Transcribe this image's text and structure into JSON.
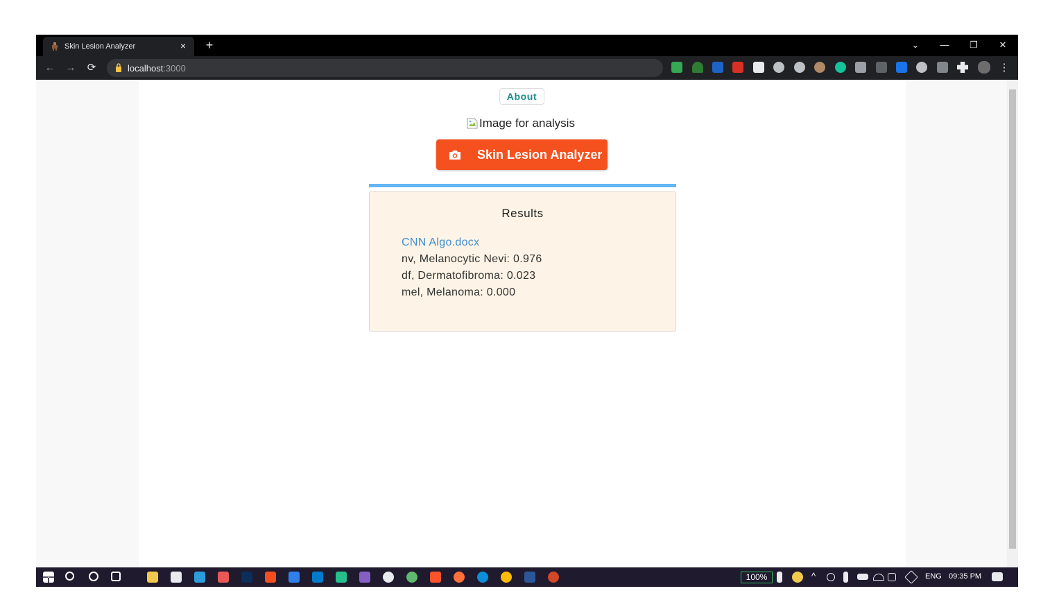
{
  "browser": {
    "tab_title": "Skin Lesion Analyzer",
    "tab_close": "×",
    "new_tab": "+",
    "url_host": "localhost",
    "url_port": ":3000",
    "nav_back": "←",
    "nav_forward": "→",
    "nav_reload": "⟳",
    "menu": "⋮",
    "window_controls": {
      "dropdown": "⌄",
      "minimize": "—",
      "restore": "❐",
      "close": "✕"
    }
  },
  "page": {
    "about_label": "About",
    "image_alt": "Image for analysis",
    "analyzer_label": "Skin Lesion Analyzer",
    "results": {
      "title": "Results",
      "filename": "CNN Algo.docx",
      "predictions": [
        "nv, Melanocytic Nevi: 0.976",
        "df, Dermatofibroma: 0.023",
        "mel, Melanoma: 0.000"
      ]
    }
  },
  "taskbar": {
    "battery": "100%",
    "language": "ENG",
    "time": "09:35 PM"
  },
  "colors": {
    "accent_orange": "#f4511e",
    "teal": "#1b8a8a",
    "link_blue": "#3f8fd0",
    "progress_blue": "#64b5f6",
    "results_bg": "#fdf3e6"
  }
}
